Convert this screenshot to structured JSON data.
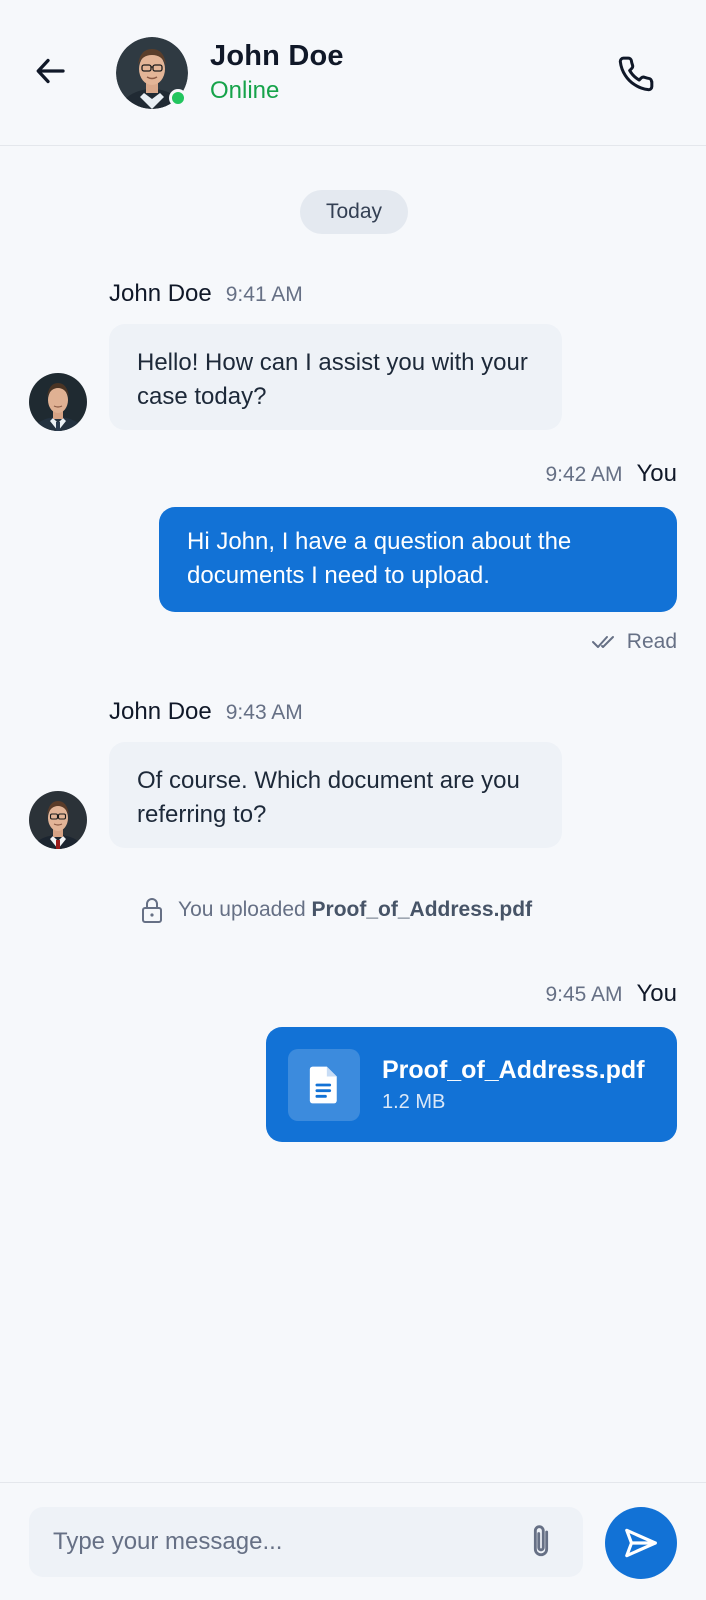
{
  "header": {
    "contact_name": "John Doe",
    "status": "Online",
    "status_color": "#16a34a",
    "icons": {
      "back": "arrow-left-icon",
      "call": "phone-icon"
    }
  },
  "date_divider": "Today",
  "messages": [
    {
      "sender": "John Doe",
      "time": "9:41 AM",
      "text": "Hello! How can I assist you with your case today?",
      "direction": "incoming"
    },
    {
      "sender": "You",
      "time": "9:42 AM",
      "text": "Hi John, I have a question about the documents I need to upload.",
      "direction": "outgoing",
      "status": "Read"
    },
    {
      "sender": "John Doe",
      "time": "9:43 AM",
      "text": "Of course. Which document are you referring to?",
      "direction": "incoming"
    }
  ],
  "system_note": {
    "prefix": "You uploaded",
    "file": "Proof_of_Address.pdf",
    "icon": "lock-icon"
  },
  "file_message": {
    "sender": "You",
    "time": "9:45 AM",
    "file_name": "Proof_of_Address.pdf",
    "file_size": "1.2 MB",
    "icon": "document-icon"
  },
  "composer": {
    "placeholder": "Type your message...",
    "attach_icon": "paperclip-icon",
    "send_icon": "send-icon"
  },
  "colors": {
    "accent": "#1272d6",
    "online": "#22c55e",
    "incoming_bubble": "#eef2f7"
  }
}
